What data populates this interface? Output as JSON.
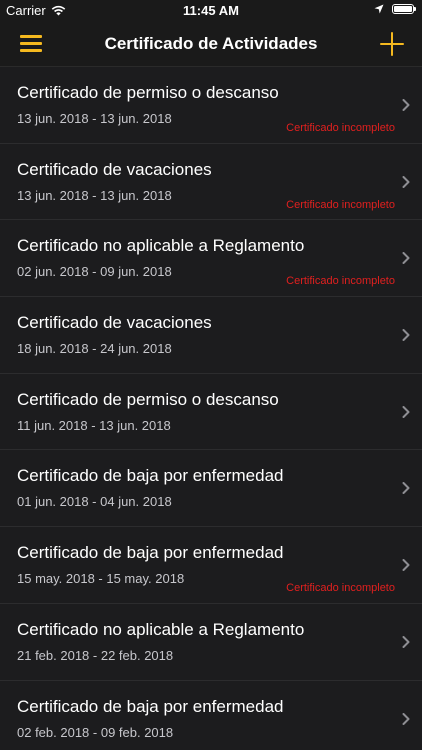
{
  "status_bar": {
    "carrier": "Carrier",
    "time": "11:45 AM"
  },
  "nav": {
    "title": "Certificado de Actividades",
    "menu_icon": "hamburger-menu-icon",
    "add_icon": "plus-icon",
    "accent_color": "#f5b91f"
  },
  "list": {
    "items": [
      {
        "title": "Certificado de permiso o descanso",
        "dates": "13 jun. 2018 - 13 jun. 2018",
        "status": "Certificado incompleto"
      },
      {
        "title": "Certificado de vacaciones",
        "dates": "13 jun. 2018 - 13 jun. 2018",
        "status": "Certificado incompleto"
      },
      {
        "title": "Certificado no aplicable a Reglamento",
        "dates": "02 jun. 2018 - 09 jun. 2018",
        "status": "Certificado incompleto"
      },
      {
        "title": "Certificado de vacaciones",
        "dates": "18 jun. 2018 - 24 jun. 2018",
        "status": ""
      },
      {
        "title": "Certificado de permiso o descanso",
        "dates": "11 jun. 2018 - 13 jun. 2018",
        "status": ""
      },
      {
        "title": "Certificado de baja por enfermedad",
        "dates": "01 jun. 2018 - 04 jun. 2018",
        "status": ""
      },
      {
        "title": "Certificado de baja por enfermedad",
        "dates": "15 may. 2018 - 15 may. 2018",
        "status": "Certificado incompleto"
      },
      {
        "title": "Certificado no aplicable a Reglamento",
        "dates": "21 feb. 2018 - 22 feb. 2018",
        "status": ""
      },
      {
        "title": "Certificado de baja por enfermedad",
        "dates": "02 feb. 2018 - 09 feb. 2018",
        "status": ""
      }
    ],
    "status_color": "#e0201f"
  }
}
